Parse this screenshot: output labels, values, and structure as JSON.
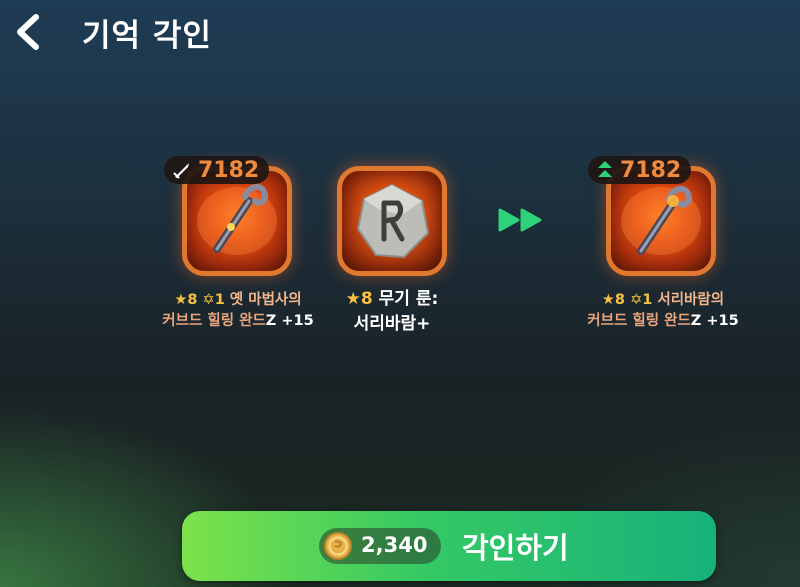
{
  "header": {
    "title": "기억 각인"
  },
  "source_item": {
    "power": "7182",
    "star": "★8",
    "enhance": "✡1",
    "name_line1": "옛 마법사의",
    "name_line2_prefix": "커브드 힐링 완드",
    "grade": "Z",
    "level": "+15"
  },
  "rune_item": {
    "star": "★8",
    "name_line1": "무기 룬:",
    "name_line2": "서리바람+"
  },
  "result_item": {
    "power": "7182",
    "star": "★8",
    "enhance": "✡1",
    "name_line1": "서리바람의",
    "name_line2_prefix": "커브드 힐링 완드",
    "grade": "Z",
    "level": "+15"
  },
  "action": {
    "cost": "2,340",
    "label": "각인하기"
  },
  "colors": {
    "accent_orange": "#f08a3e",
    "frame_border": "#e0782f",
    "button_start": "#7de24a",
    "button_end": "#17b27a"
  },
  "icons": {
    "back": "chevron-left-icon",
    "attack": "sword-icon",
    "upgrade": "double-up-arrow-icon",
    "arrows": "fast-forward-icon",
    "coin": "coin-icon"
  }
}
